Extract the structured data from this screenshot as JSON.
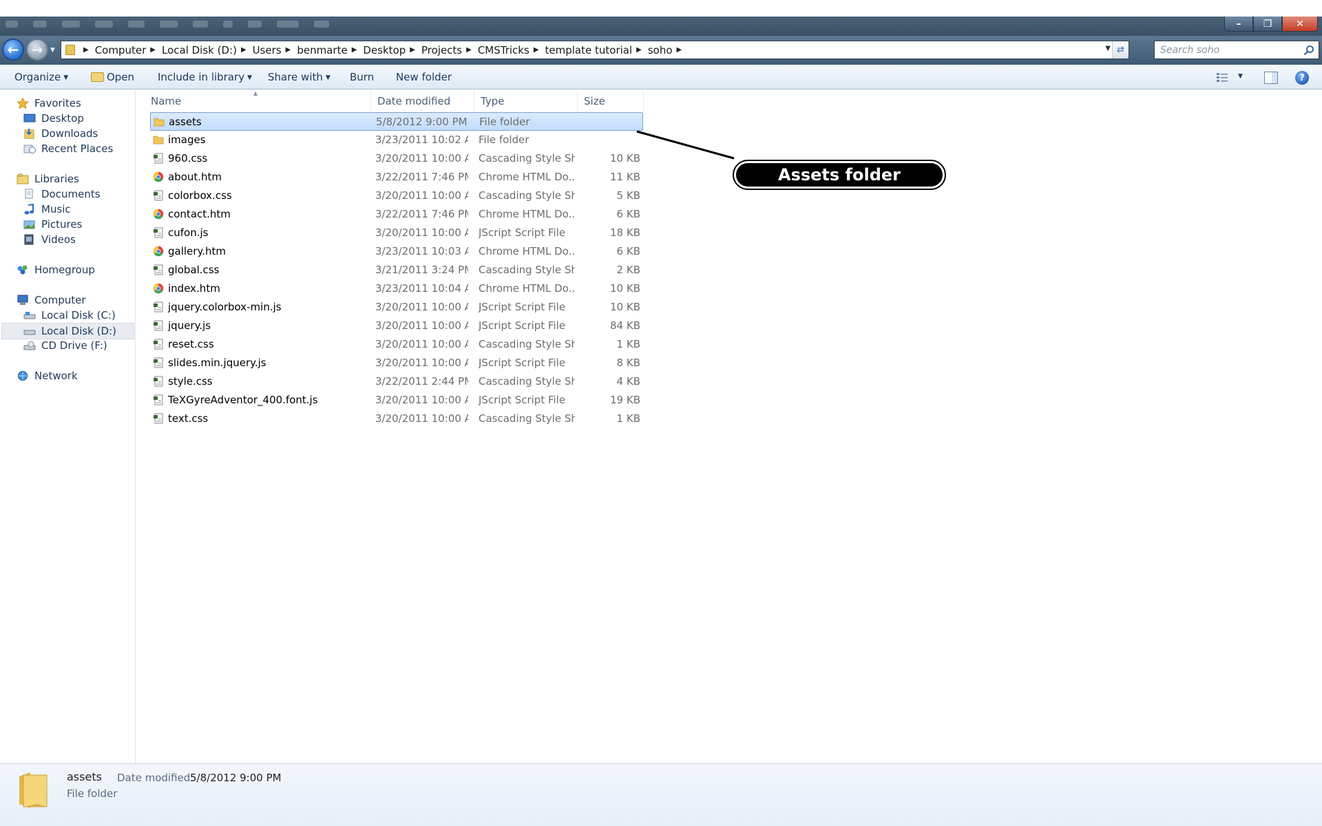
{
  "address": {
    "crumbs": [
      "Computer",
      "Local Disk (D:)",
      "Users",
      "benmarte",
      "Desktop",
      "Projects",
      "CMSTricks",
      "template tutorial",
      "soho"
    ]
  },
  "search": {
    "placeholder": "Search soho"
  },
  "toolbar": {
    "organize": "Organize",
    "open": "Open",
    "include_in_library": "Include in library",
    "share_with": "Share with",
    "burn": "Burn",
    "new_folder": "New folder"
  },
  "nav": {
    "favorites": "Favorites",
    "desktop": "Desktop",
    "downloads": "Downloads",
    "recent_places": "Recent Places",
    "libraries": "Libraries",
    "documents": "Documents",
    "music": "Music",
    "pictures": "Pictures",
    "videos": "Videos",
    "homegroup": "Homegroup",
    "computer": "Computer",
    "local_c": "Local Disk (C:)",
    "local_d": "Local Disk (D:)",
    "cd_drive": "CD Drive (F:)",
    "network": "Network"
  },
  "columns": {
    "name": "Name",
    "date": "Date modified",
    "type": "Type",
    "size": "Size"
  },
  "files": [
    {
      "name": "assets",
      "date": "5/8/2012 9:00 PM",
      "type": "File folder",
      "size": "",
      "icon": "folder"
    },
    {
      "name": "images",
      "date": "3/23/2011 10:02 A...",
      "type": "File folder",
      "size": "",
      "icon": "folder"
    },
    {
      "name": "960.css",
      "date": "3/20/2011 10:00 A...",
      "type": "Cascading Style Sh...",
      "size": "10 KB",
      "icon": "script"
    },
    {
      "name": "about.htm",
      "date": "3/22/2011 7:46 PM",
      "type": "Chrome HTML Do...",
      "size": "11 KB",
      "icon": "chrome"
    },
    {
      "name": "colorbox.css",
      "date": "3/20/2011 10:00 A...",
      "type": "Cascading Style Sh...",
      "size": "5 KB",
      "icon": "script"
    },
    {
      "name": "contact.htm",
      "date": "3/22/2011 7:46 PM",
      "type": "Chrome HTML Do...",
      "size": "6 KB",
      "icon": "chrome"
    },
    {
      "name": "cufon.js",
      "date": "3/20/2011 10:00 A...",
      "type": "JScript Script File",
      "size": "18 KB",
      "icon": "script"
    },
    {
      "name": "gallery.htm",
      "date": "3/23/2011 10:03 A...",
      "type": "Chrome HTML Do...",
      "size": "6 KB",
      "icon": "chrome"
    },
    {
      "name": "global.css",
      "date": "3/21/2011 3:24 PM",
      "type": "Cascading Style Sh...",
      "size": "2 KB",
      "icon": "script"
    },
    {
      "name": "index.htm",
      "date": "3/23/2011 10:04 A...",
      "type": "Chrome HTML Do...",
      "size": "10 KB",
      "icon": "chrome"
    },
    {
      "name": "jquery.colorbox-min.js",
      "date": "3/20/2011 10:00 A...",
      "type": "JScript Script File",
      "size": "10 KB",
      "icon": "script"
    },
    {
      "name": "jquery.js",
      "date": "3/20/2011 10:00 A...",
      "type": "JScript Script File",
      "size": "84 KB",
      "icon": "script"
    },
    {
      "name": "reset.css",
      "date": "3/20/2011 10:00 A...",
      "type": "Cascading Style Sh...",
      "size": "1 KB",
      "icon": "script"
    },
    {
      "name": "slides.min.jquery.js",
      "date": "3/20/2011 10:00 A...",
      "type": "JScript Script File",
      "size": "8 KB",
      "icon": "script"
    },
    {
      "name": "style.css",
      "date": "3/22/2011 2:44 PM",
      "type": "Cascading Style Sh...",
      "size": "4 KB",
      "icon": "script"
    },
    {
      "name": "TeXGyreAdventor_400.font.js",
      "date": "3/20/2011 10:00 A...",
      "type": "JScript Script File",
      "size": "19 KB",
      "icon": "script"
    },
    {
      "name": "text.css",
      "date": "3/20/2011 10:00 A...",
      "type": "Cascading Style Sh...",
      "size": "1 KB",
      "icon": "script"
    }
  ],
  "selected_index": 0,
  "callout": {
    "text": "Assets folder"
  },
  "details": {
    "name": "assets",
    "date_label": "Date modified:",
    "date_value": "5/8/2012 9:00 PM",
    "type": "File folder"
  },
  "colors": {
    "selection": "#cce4fc",
    "nav_text": "#1e395b",
    "folder": "#f0c75e"
  }
}
